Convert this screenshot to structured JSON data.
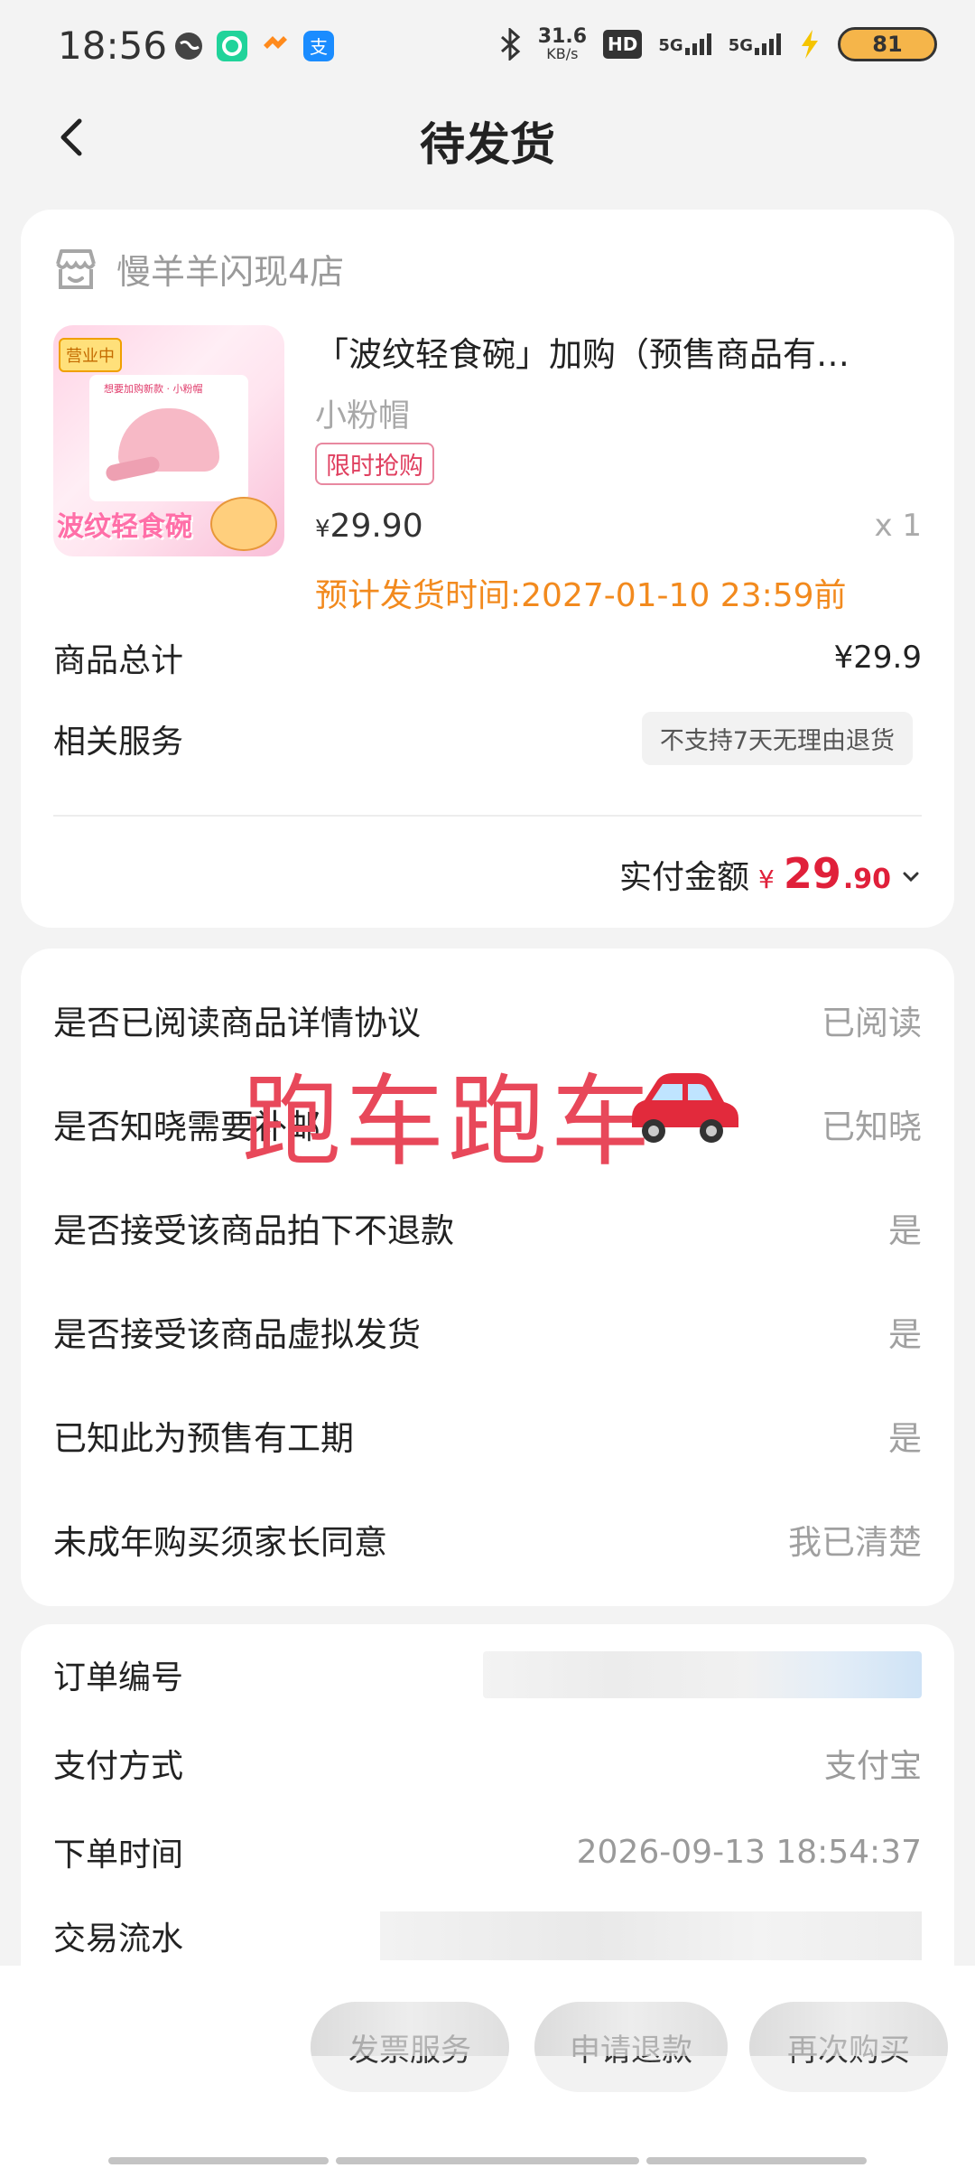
{
  "status": {
    "time": "18:56",
    "speed": "31.6",
    "speed_unit": "KB/s",
    "hd": "HD",
    "signal1": "5G",
    "signal2": "5G",
    "battery": "81"
  },
  "header": {
    "title": "待发货"
  },
  "order": {
    "store_name": "慢羊羊闪现4店",
    "product": {
      "title": "「波纹轻食碗」加购（预售商品有…",
      "variant": "小粉帽",
      "tag": "限时抢购",
      "price_symbol": "¥",
      "price": "29.90",
      "qty": "x 1",
      "ship_time": "预计发货时间:2027-01-10 23:59前",
      "thumb_badge": "营业中",
      "thumb_label": "想要加购新款 · 小粉帽",
      "thumb_wordart": "波纹轻食碗"
    },
    "total_label": "商品总计",
    "total_value": "¥29.9",
    "service_label": "相关服务",
    "service_tag": "不支持7天无理由退货",
    "paid_label": "实付金额",
    "paid_symbol": "¥",
    "paid_int": "29",
    "paid_dec": ".90"
  },
  "agreements": [
    {
      "q": "是否已阅读商品详情协议",
      "a": "已阅读"
    },
    {
      "q": "是否知晓需要补邮",
      "a": "已知晓"
    },
    {
      "q": "是否接受该商品拍下不退款",
      "a": "是"
    },
    {
      "q": "是否接受该商品虚拟发货",
      "a": "是"
    },
    {
      "q": "已知此为预售有工期",
      "a": "是"
    },
    {
      "q": "未成年购买须家长同意",
      "a": "我已清楚"
    }
  ],
  "overlay": {
    "text": "跑车跑车"
  },
  "details": {
    "order_no_label": "订单编号",
    "pay_method_label": "支付方式",
    "pay_method": "支付宝",
    "order_time_label": "下单时间",
    "order_time": "2026-09-13 18:54:37",
    "trade_no_label": "交易流水"
  },
  "bottom_bar": {
    "invoice": "发票服务",
    "apply": "申请退款",
    "rebuy": "再次购买"
  }
}
